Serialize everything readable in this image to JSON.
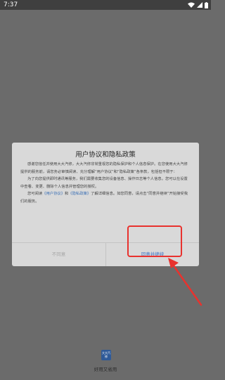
{
  "status_bar": {
    "time": "7:37"
  },
  "dialog": {
    "title": "用户协议和隐私政策",
    "paragraph1": "感谢您信任并使用大大汽修，大大汽修非常重视您的隐私保护和个人信息保护。在您使用大大汽修提供的服务前，请您务必审慎阅读、充分理解“用户协议”和“隐私政策”各条款，包括但不限于：",
    "paragraph2": "为了向您提供即时通讯等服务，我们需要收集您的设备信息、操作日志等个人信息。您可以在设置中查看、变更、删除个人信息并管理您的授权。",
    "paragraph3_before": "您可阅读",
    "user_agreement_link": "《用户协议》",
    "paragraph3_and": "和",
    "privacy_policy_link": "《隐私政策》",
    "paragraph3_after": "了解详细信息。如您同意，请点击“同意并继续”开始接受我们的服务。",
    "disagree_label": "不同意",
    "agree_label": "同意并继续"
  },
  "footer": {
    "logo_text": "大大汽修",
    "slogan": "好用又省用"
  },
  "colors": {
    "overlay": "#6b6b6b",
    "dialog_bg": "#d9d9d9",
    "agree_text": "#3d73c4",
    "disagree_text": "#a5a5a5",
    "highlight": "#e8322e",
    "logo_bg": "#2f5a98"
  },
  "icons": [
    "settings-icon",
    "play-protect-icon",
    "wifi-icon",
    "signal-icon",
    "battery-icon"
  ]
}
